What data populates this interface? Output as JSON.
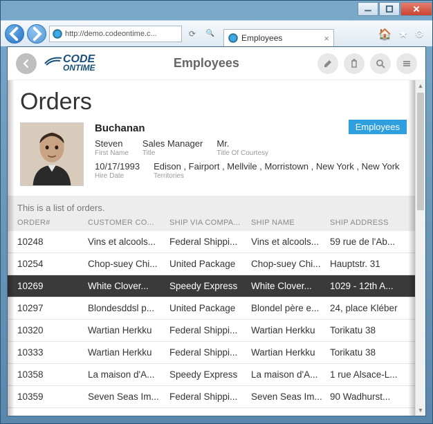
{
  "browser": {
    "url": "http://demo.codeontime.c...",
    "tab_title": "Employees"
  },
  "app": {
    "logo_line1": "CODE",
    "logo_line2": "ONTIME",
    "header_title": "Employees"
  },
  "page": {
    "heading": "Orders",
    "badge": "Employees",
    "list_description": "This is a list of orders."
  },
  "employee": {
    "last_name": "Buchanan",
    "first_name": {
      "value": "Steven",
      "label": "First Name"
    },
    "title": {
      "value": "Sales Manager",
      "label": "Title"
    },
    "courtesy": {
      "value": "Mr.",
      "label": "Title Of Courtesy"
    },
    "hire_date": {
      "value": "10/17/1993",
      "label": "Hire Date"
    },
    "territories": {
      "value": "Edison , Fairport , Mellvile , Morristown , New York , New York",
      "label": "Territories"
    }
  },
  "columns": [
    "ORDER#",
    "CUSTOMER CO...",
    "SHIP VIA COMPA...",
    "SHIP NAME",
    "SHIP ADDRESS"
  ],
  "rows": [
    {
      "order": "10248",
      "customer": "Vins et alcools...",
      "shipvia": "Federal Shippi...",
      "shipname": "Vins et alcools...",
      "addr": "59 rue de l'Ab..."
    },
    {
      "order": "10254",
      "customer": "Chop-suey Chi...",
      "shipvia": "United Package",
      "shipname": "Chop-suey Chi...",
      "addr": "Hauptstr. 31"
    },
    {
      "order": "10269",
      "customer": "White Clover...",
      "shipvia": "Speedy Express",
      "shipname": "White Clover...",
      "addr": "1029 - 12th A...",
      "selected": true
    },
    {
      "order": "10297",
      "customer": "Blondesddsl p...",
      "shipvia": "United Package",
      "shipname": "Blondel père e...",
      "addr": "24, place Kléber"
    },
    {
      "order": "10320",
      "customer": "Wartian Herkku",
      "shipvia": "Federal Shippi...",
      "shipname": "Wartian Herkku",
      "addr": "Torikatu 38"
    },
    {
      "order": "10333",
      "customer": "Wartian Herkku",
      "shipvia": "Federal Shippi...",
      "shipname": "Wartian Herkku",
      "addr": "Torikatu 38"
    },
    {
      "order": "10358",
      "customer": "La maison d'A...",
      "shipvia": "Speedy Express",
      "shipname": "La maison d'A...",
      "addr": "1 rue Alsace-L..."
    },
    {
      "order": "10359",
      "customer": "Seven Seas Im...",
      "shipvia": "Federal Shippi...",
      "shipname": "Seven Seas Im...",
      "addr": "90 Wadhurst..."
    }
  ]
}
